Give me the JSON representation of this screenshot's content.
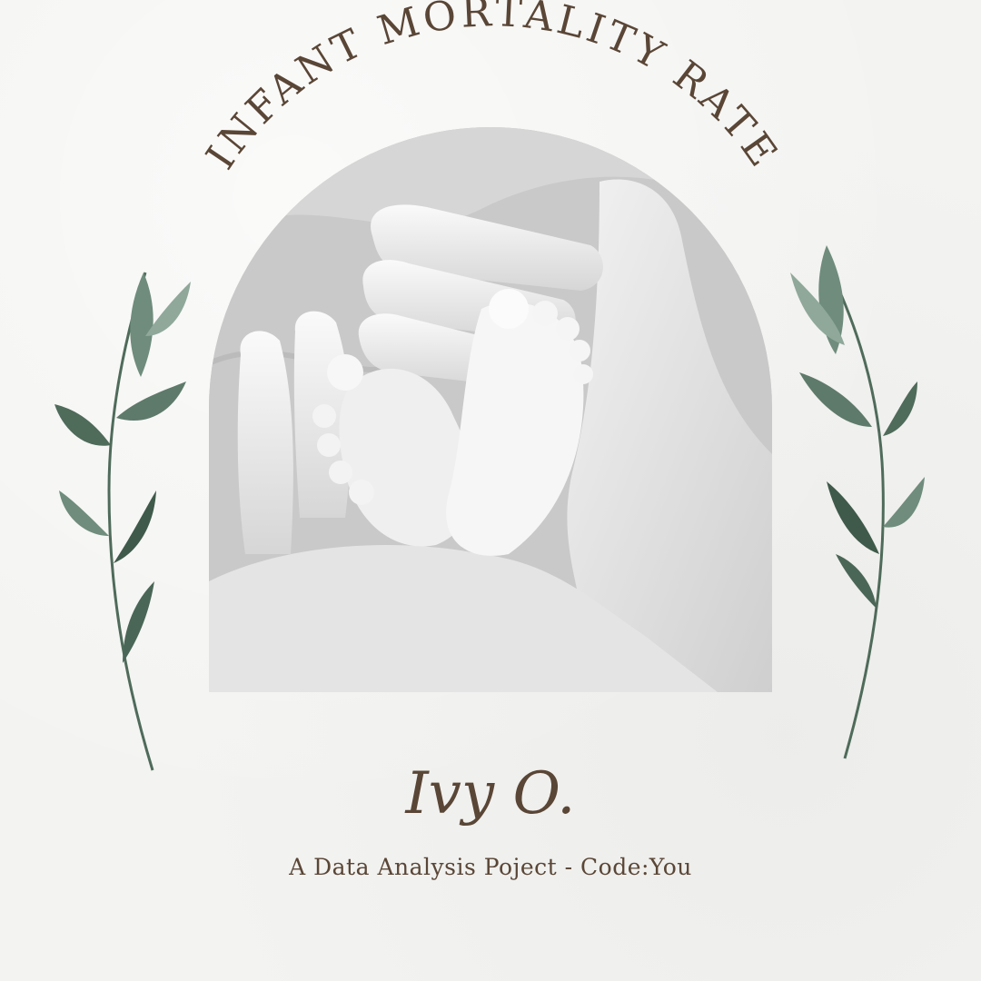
{
  "title": "INFANT MORTALITY RATE",
  "signature": "Ivy O.",
  "subtitle": "A Data Analysis Poject - Code:You",
  "colors": {
    "background": "#f3f3f1",
    "text_brown": "#5a4636",
    "leaf_green": "#4f6b5a",
    "leaf_light": "#8fa89a"
  },
  "icons": {
    "left_branch": "eucalyptus-branch-icon",
    "right_branch": "eucalyptus-branch-icon"
  }
}
